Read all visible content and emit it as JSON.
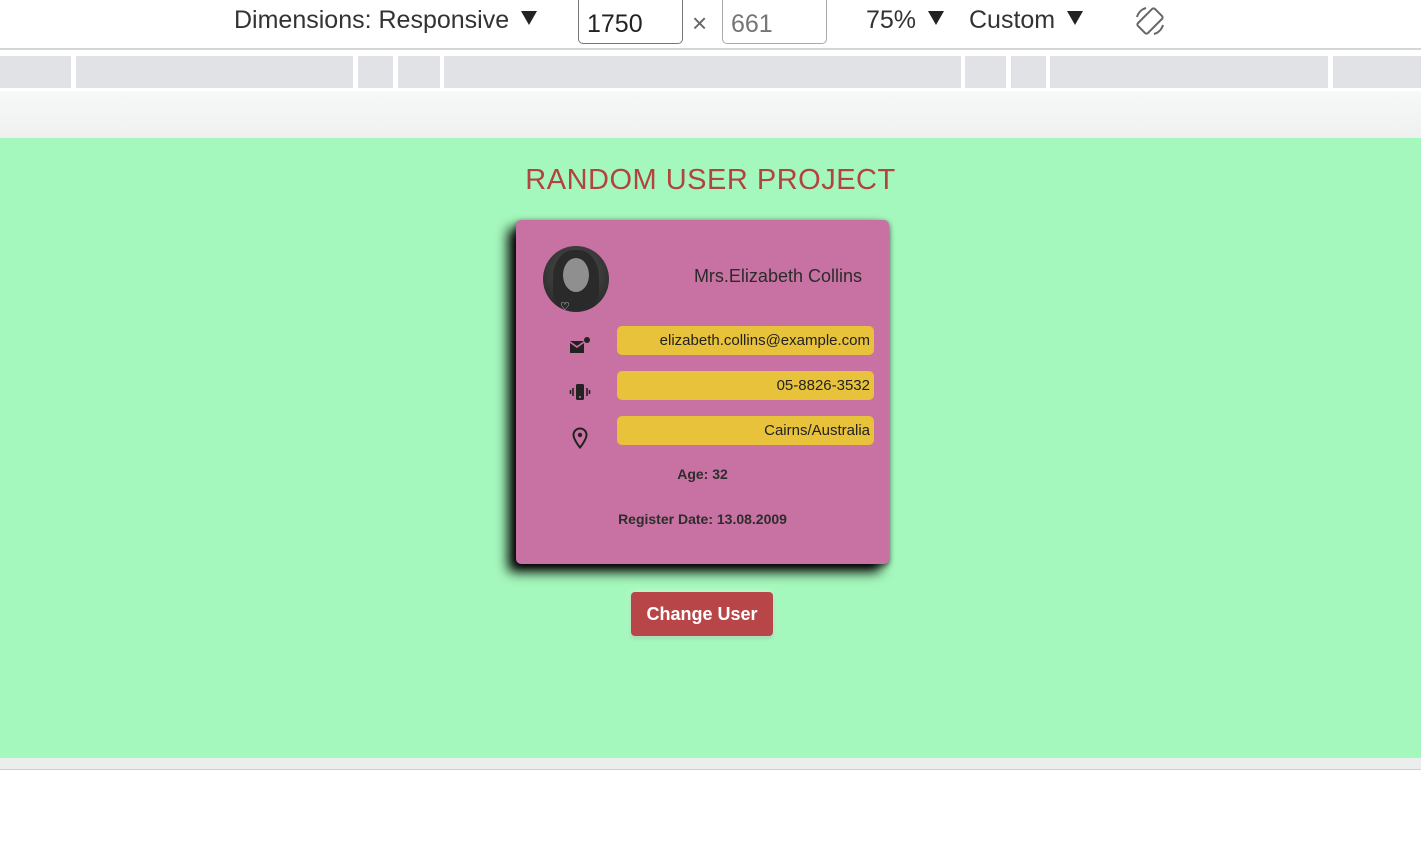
{
  "devtools": {
    "dimensions_label": "Dimensions: Responsive",
    "width_value": "1750",
    "height_placeholder": "661",
    "times_symbol": "×",
    "zoom": "75%",
    "throttle": "Custom"
  },
  "page": {
    "title": "RANDOM USER PROJECT",
    "user": {
      "name": "Mrs.Elizabeth Collins",
      "email": "elizabeth.collins@example.com",
      "phone": "05-8826-3532",
      "location": "Cairns/Australia",
      "age": "Age: 32",
      "register_date": "Register Date: 13.08.2009"
    },
    "change_button": "Change User"
  },
  "colors": {
    "viewport_bg": "#a5f8bd",
    "title": "#b2443f",
    "card": "#c772a2",
    "pill": "#e8c23b",
    "button": "#b84547"
  },
  "icons": {
    "email": "email-icon",
    "phone": "phone-vibrate-icon",
    "location": "location-pin-icon",
    "rotate": "rotate-device-icon"
  }
}
